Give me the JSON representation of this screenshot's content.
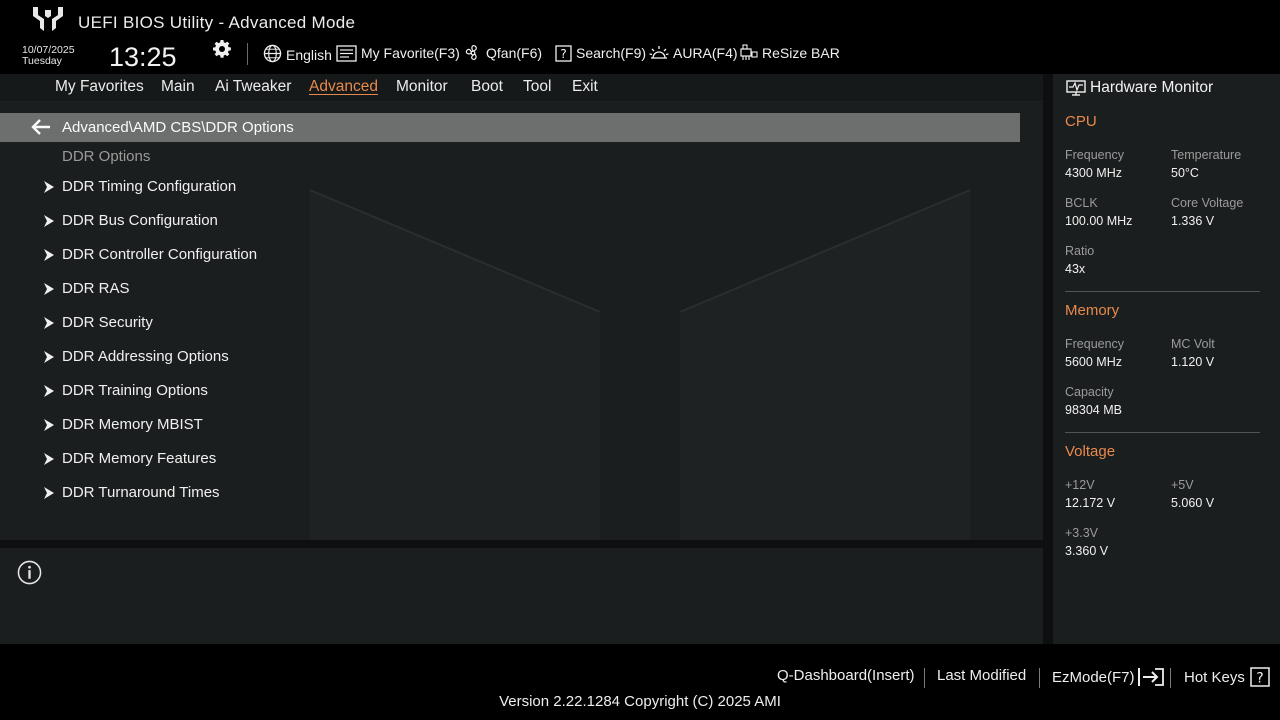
{
  "app": {
    "title": "UEFI BIOS Utility - Advanced Mode"
  },
  "header": {
    "date": "10/07/2025",
    "day": "Tuesday",
    "time": "13:25",
    "toolbar": [
      {
        "label": "English",
        "icon": "globe-icon"
      },
      {
        "label": "My Favorite(F3)",
        "icon": "favorite-list-icon"
      },
      {
        "label": "Qfan(F6)",
        "icon": "fan-icon"
      },
      {
        "label": "Search(F9)",
        "icon": "search-question-icon"
      },
      {
        "label": "AURA(F4)",
        "icon": "aura-light-icon"
      },
      {
        "label": "ReSize BAR",
        "icon": "resize-bar-icon"
      }
    ]
  },
  "menu": {
    "tabs": [
      "My Favorites",
      "Main",
      "Ai Tweaker",
      "Advanced",
      "Monitor",
      "Boot",
      "Tool",
      "Exit"
    ],
    "active": "Advanced"
  },
  "main": {
    "path": "Advanced\\AMD CBS\\DDR Options",
    "section_label": "DDR Options",
    "entries": [
      "DDR Timing Configuration",
      "DDR Bus Configuration",
      "DDR Controller Configuration",
      "DDR RAS",
      "DDR Security",
      "DDR Addressing Options",
      "DDR Training Options",
      "DDR Memory MBIST",
      "DDR Memory Features",
      "DDR Turnaround Times"
    ]
  },
  "hardware_monitor": {
    "title": "Hardware Monitor",
    "cpu": {
      "heading": "CPU",
      "frequency_label": "Frequency",
      "frequency": "4300 MHz",
      "temperature_label": "Temperature",
      "temperature": "50°C",
      "bclk_label": "BCLK",
      "bclk": "100.00 MHz",
      "core_voltage_label": "Core Voltage",
      "core_voltage": "1.336 V",
      "ratio_label": "Ratio",
      "ratio": "43x"
    },
    "memory": {
      "heading": "Memory",
      "frequency_label": "Frequency",
      "frequency": "5600 MHz",
      "mc_volt_label": "MC Volt",
      "mc_volt": "1.120 V",
      "capacity_label": "Capacity",
      "capacity": "98304 MB"
    },
    "voltage": {
      "heading": "Voltage",
      "v12_label": "+12V",
      "v12": "12.172 V",
      "v5_label": "+5V",
      "v5": "5.060 V",
      "v33_label": "+3.3V",
      "v33": "3.360 V"
    }
  },
  "footer": {
    "q_dashboard": "Q-Dashboard(Insert)",
    "last_modified": "Last Modified",
    "ezmode": "EzMode(F7)",
    "hot_keys": "Hot Keys",
    "version": "Version 2.22.1284 Copyright (C) 2025 AMI"
  },
  "colors": {
    "accent": "#e8894c",
    "path_bar": "#6d6e6e",
    "panel": "#1b1e1f"
  }
}
